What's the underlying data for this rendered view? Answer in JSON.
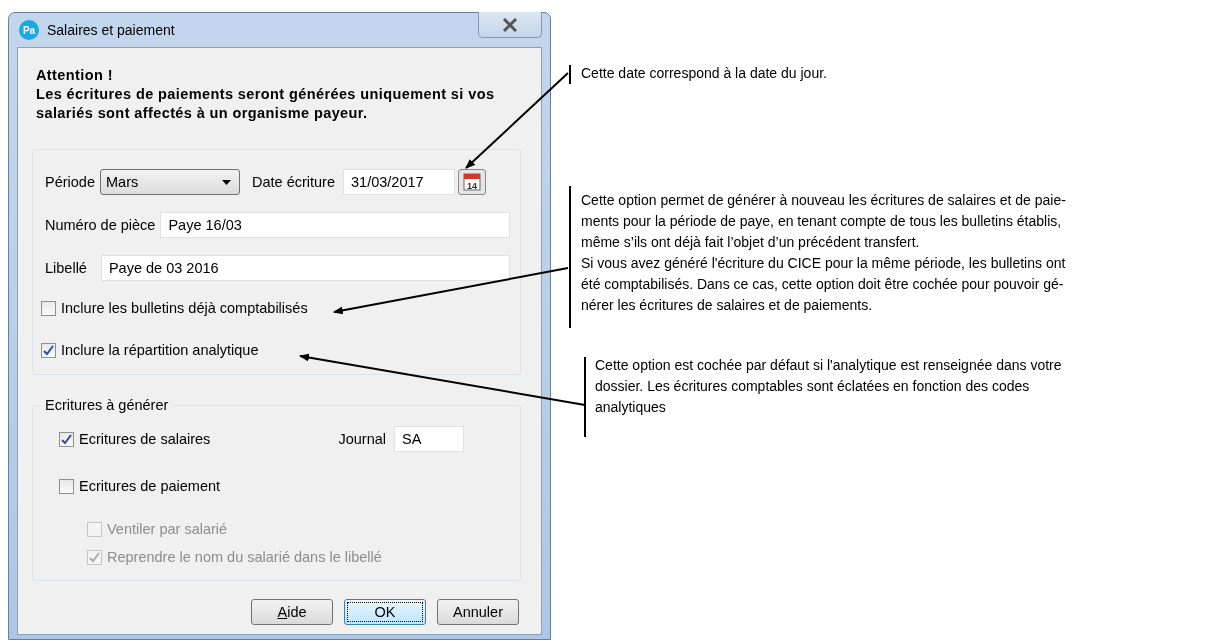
{
  "window": {
    "title": "Salaires et paiement",
    "app_badge": "Pa"
  },
  "warning": {
    "heading": "Attention !",
    "message": "Les écritures de paiements seront générées uniquement si vos salariés sont affectés à un organisme payeur."
  },
  "period": {
    "label": "Période",
    "value": "Mars"
  },
  "entry_date": {
    "label": "Date écriture",
    "value": "31/03/2017",
    "calendar_day": "14"
  },
  "document_number": {
    "label": "Numéro de pièce",
    "value": "Paye 16/03"
  },
  "description": {
    "label": "Libellé",
    "value": "Paye de 03 2016"
  },
  "options": [
    {
      "label": "Inclure les bulletins déjà comptabilisés",
      "checked": false,
      "disabled": false
    },
    {
      "label": "Inclure la répartition analytique",
      "checked": true,
      "disabled": false
    }
  ],
  "entries_group": {
    "title": "Ecritures à générer",
    "items": [
      {
        "label": "Ecritures de salaires",
        "checked": true,
        "disabled": false
      },
      {
        "label": "Ecritures de paiement",
        "checked": false,
        "disabled": false,
        "children": [
          {
            "label": "Ventiler par salarié",
            "checked": false,
            "disabled": true
          },
          {
            "label": "Reprendre le nom du salarié dans le libellé",
            "checked": true,
            "disabled": true
          }
        ]
      }
    ],
    "journal": {
      "label": "Journal",
      "value": "SA"
    }
  },
  "buttons": [
    {
      "label": "Aide",
      "default": false,
      "underline_first": true
    },
    {
      "label": "OK",
      "default": true,
      "underline_first": false
    },
    {
      "label": "Annuler",
      "default": false,
      "underline_first": false
    }
  ],
  "notes": [
    {
      "lines": [
        "Cette date correspond à la date du jour."
      ]
    },
    {
      "lines": [
        "Cette option permet de générer à nouveau les écritures de salaires et de paie-",
        "ments pour la période de paye, en tenant compte de tous les bulletins établis,",
        "même s’ils ont déjà fait l’objet d’un précédent transfert.",
        "Si vous avez généré l'écriture du CICE pour la même période, les bulletins ont",
        "été comptabilisés. Dans ce cas, cette option doit être cochée pour pouvoir gé-",
        "nérer les écritures de salaires et de paiements."
      ]
    },
    {
      "lines": [
        "Cette option est cochée par défaut si l'analytique est renseignée dans votre",
        "dossier. Les écritures comptables sont éclatées en fonction des codes",
        "analytiques"
      ]
    }
  ]
}
